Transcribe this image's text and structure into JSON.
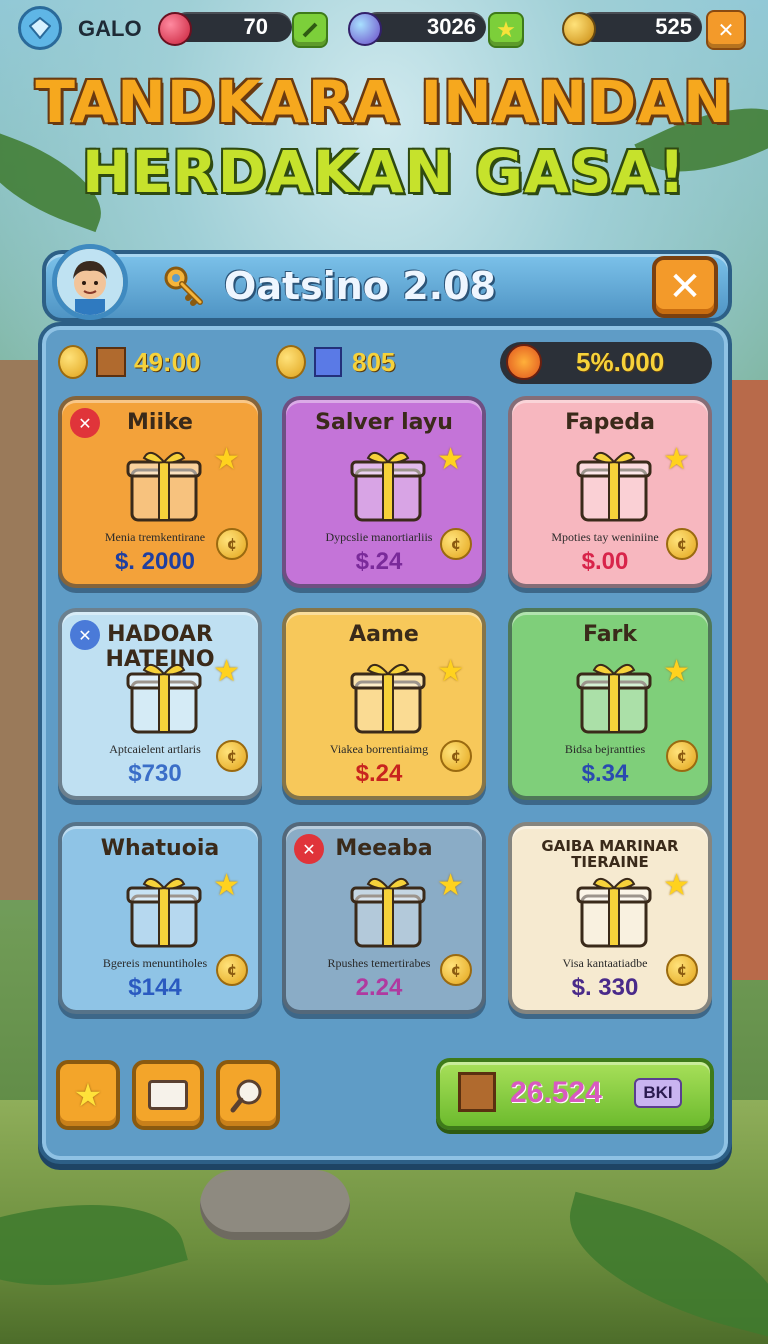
{
  "hud": {
    "player_name": "GALO",
    "gem_count": "70",
    "orb_count": "3026",
    "trophy_count": "525",
    "close_label": "✕"
  },
  "headline": {
    "line1": "TANDKARA INANDAN",
    "line2": "HERDAKAN GASA!"
  },
  "shop": {
    "title": "Oatsino 2.08",
    "close_label": "✕",
    "stats": {
      "crates": "49:00",
      "cubes": "805",
      "total": "5%.000"
    },
    "items": [
      {
        "title": "Miike",
        "desc": "Menia tremkentirane",
        "price": "$. 2000",
        "price_color": "#1f3fa0",
        "bg": "#f3a23a"
      },
      {
        "title": "Salver layu",
        "desc": "Dypcslie manortiarliis",
        "price": "$.24",
        "price_color": "#7a2a9a",
        "bg": "#c474d8"
      },
      {
        "title": "Fapeda",
        "desc": "Mpoties tay weniniine",
        "price": "$.00",
        "price_color": "#d8244a",
        "bg": "#f7b7bf"
      },
      {
        "title": "HADOAR HATEINO",
        "desc": "Aptcaielent artlaris",
        "price": "$730",
        "price_color": "#3a6ec8",
        "bg": "#bfe0f2"
      },
      {
        "title": "Aame",
        "desc": "Viakea borrentiaimg",
        "price": "$.24",
        "price_color": "#c8241e",
        "bg": "#f7c85a"
      },
      {
        "title": "Fark",
        "desc": "Bidsa bejrantties",
        "price": "$.34",
        "price_color": "#2a4ab0",
        "bg": "#7fcf7a"
      },
      {
        "title": "Whatuoia",
        "desc": "Bgereis menuntiholes",
        "price": "$144",
        "price_color": "#2a5ac0",
        "bg": "#8fc4e6"
      },
      {
        "title": "Meeaba",
        "desc": "Rpushes temertirabes",
        "price": "2.24",
        "price_color": "#b03aa0",
        "bg": "#8aacc6"
      },
      {
        "title": "GAIBA MARINAR TIERAINE",
        "desc": "Visa kantaatiadbe",
        "price": "$. 330",
        "price_color": "#4a2a8a",
        "bg": "#f6ead0"
      }
    ],
    "buy": {
      "amount": "26.524",
      "tag": "BKI"
    }
  }
}
